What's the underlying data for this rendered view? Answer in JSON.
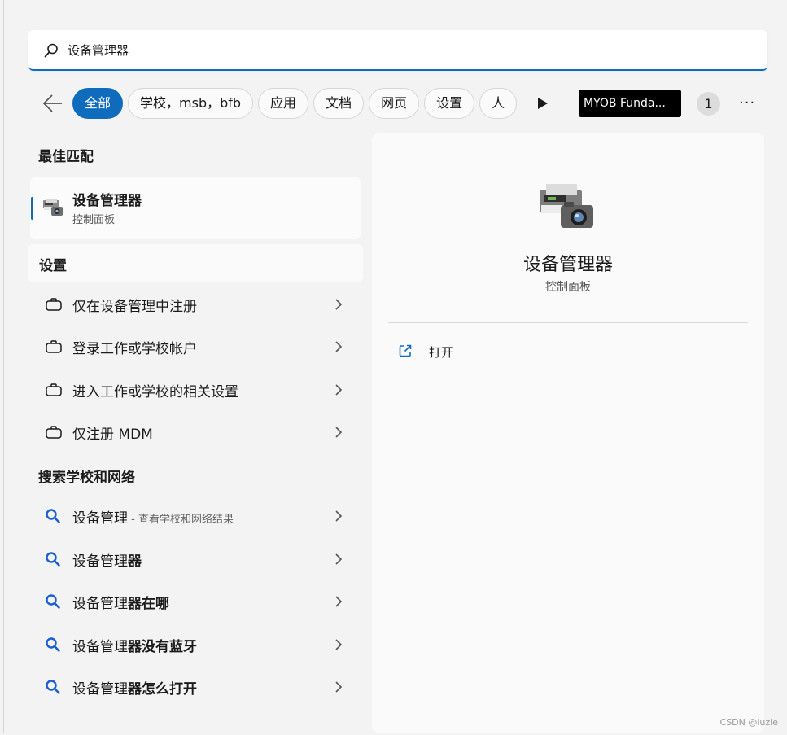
{
  "search": {
    "value": "设备管理器"
  },
  "filters": {
    "chips": [
      "全部",
      "学校，msb，bfb",
      "应用",
      "文档",
      "网页",
      "设置",
      "人"
    ],
    "org_label": "MYOB Funda...",
    "count": "1",
    "more": "···"
  },
  "best_match": {
    "section_title": "最佳匹配",
    "title": "设备管理器",
    "subtitle": "控制面板"
  },
  "settings": {
    "section_title": "设置",
    "items": [
      "仅在设备管理中注册",
      "登录工作或学校帐户",
      "进入工作或学校的相关设置",
      "仅注册 MDM"
    ]
  },
  "web_search": {
    "section_title": "搜索学校和网络",
    "items": [
      {
        "prefix": "设备管理",
        "bold": "",
        "hint": " - 查看学校和网络结果"
      },
      {
        "prefix": "设备管理",
        "bold": "器",
        "hint": ""
      },
      {
        "prefix": "设备管理",
        "bold": "器在哪",
        "hint": ""
      },
      {
        "prefix": "设备管理",
        "bold": "器没有蓝牙",
        "hint": ""
      },
      {
        "prefix": "设备管理",
        "bold": "器怎么打开",
        "hint": ""
      }
    ]
  },
  "detail": {
    "title": "设备管理器",
    "subtitle": "控制面板",
    "action_open": "打开"
  },
  "watermark": "CSDN @luzle",
  "colors": {
    "accent": "#0f6cbd",
    "background": "#f3f3f3",
    "search_icon_blue": "#1a5fd1"
  }
}
